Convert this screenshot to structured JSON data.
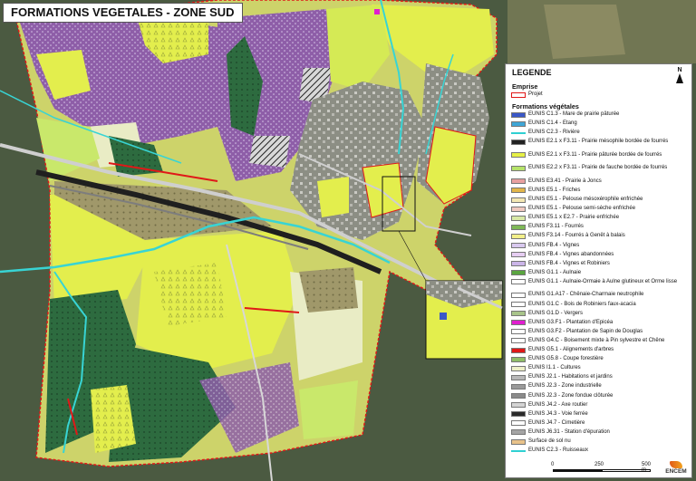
{
  "map": {
    "title": "FORMATIONS VEGETALES - ZONE SUD",
    "colors": {
      "background": "#4b5a41",
      "pasture": "#e3f04a",
      "hay_meadow": "#c9e86b",
      "forest": "#2f6a3e",
      "vineyard": "#8e5ea8",
      "orchard": "#9aa86b",
      "crops": "#e9ecc5",
      "urban": "#8e8e8a",
      "railway": "#1f1f1f",
      "road": "#bdbdbd",
      "river": "#38d4d4",
      "boundary": "#e01818"
    }
  },
  "legend": {
    "title": "LEGENDE",
    "north_label": "N",
    "emprise_title": "Emprise",
    "projet_label": "Projet",
    "formations_title": "Formations végétales",
    "items": [
      {
        "label": "EUNIS C1.3 - Mare de prairie pâturée",
        "color": "#3a57c7"
      },
      {
        "label": "EUNIS C1.4 - Etang",
        "color": "#3fa6d6"
      },
      {
        "label": "EUNIS C2.3 - Rivière",
        "color": "#2fd0d2"
      },
      {
        "label": "EUNIS E2.1 x F3.11 - Prairie mésophile bordée de fourrés",
        "color": "#222222"
      },
      {
        "label": "EUNIS E2.1 x F3.11 - Prairie pâturée bordée de fourrés",
        "color": "#e6f046"
      },
      {
        "label": "EUNIS E2.2 x F3.11 - Prairie de fauche bordée de fourrés",
        "color": "#b6e36a"
      },
      {
        "label": "EUNIS E3.41 - Prairie à Joncs",
        "color": "#e8a0a0"
      },
      {
        "label": "EUNIS E5.1 - Friches",
        "color": "#e2b64a"
      },
      {
        "label": "EUNIS E5.1 - Pelouse mésoxérophile enfrichée",
        "color": "#f3e7b3"
      },
      {
        "label": "EUNIS E5.1 - Pelouse semi-sèche enfrichée",
        "color": "#f0c9c0"
      },
      {
        "label": "EUNIS E5.1 x E2.7 - Prairie enfrichée",
        "color": "#d9e9a6"
      },
      {
        "label": "EUNIS F3.11 - Fourrés",
        "color": "#7fb957"
      },
      {
        "label": "EUNIS F3.14 - Fourrés à Genêt à balais",
        "color": "#f2ef8a"
      },
      {
        "label": "EUNIS FB.4 - Vignes",
        "color": "#d9c9ef"
      },
      {
        "label": "EUNIS FB.4 - Vignes abandonnées",
        "color": "#e6cdf2"
      },
      {
        "label": "EUNIS FB.4 - Vignes et Robiniers",
        "color": "#cbb5e8"
      },
      {
        "label": "EUNIS G1.1 - Aulnaie",
        "color": "#5aa540"
      },
      {
        "label": "EUNIS G1.1 - Aulnaie-Ormaie à Aulne glutineux et Orme lisse",
        "color": "#ffffff"
      },
      {
        "label": "EUNIS G1.A17 - Chênaie-Charmaie neutrophile",
        "color": "#ffffff"
      },
      {
        "label": "EUNIS G1.C - Bois de Robiniers faux-acacia",
        "color": "#ffffff"
      },
      {
        "label": "EUNIS G1.D - Vergers",
        "color": "#a8c48a"
      },
      {
        "label": "EUNIS G3.F1 - Plantation d'Epicéa",
        "color": "#e01ecf"
      },
      {
        "label": "EUNIS G3.F2 - Plantation de Sapin de Douglas",
        "color": "#ffffff"
      },
      {
        "label": "EUNIS G4.C - Boisement mixte à Pin sylvestre et Chêne",
        "color": "#ffffff"
      },
      {
        "label": "EUNIS G5.1 - Alignements d'arbres",
        "color": "#e01818"
      },
      {
        "label": "EUNIS G5.8 - Coupe forestière",
        "color": "#8fbd68"
      },
      {
        "label": "EUNIS I1.1 - Cultures",
        "color": "#eef0c8"
      },
      {
        "label": "EUNIS J2.1 - Habitations et jardins",
        "color": "#b8b8b8"
      },
      {
        "label": "EUNIS J2.3 - Zone industrielle",
        "color": "#9a9a9a"
      },
      {
        "label": "EUNIS J2.3 - Zone fondue clôturée",
        "color": "#8a8a8a"
      },
      {
        "label": "EUNIS J4.2 - Axe routier",
        "color": "#d4d4d4"
      },
      {
        "label": "EUNIS J4.3 - Voie ferrée",
        "color": "#2a2a2a"
      },
      {
        "label": "EUNIS J4.7 - Cimetière",
        "color": "#ffffff"
      },
      {
        "label": "EUNIS J6.31 - Station d'épuration",
        "color": "#a5a5a5"
      },
      {
        "label": "Surface de sol nu",
        "color": "#e8c28a"
      },
      {
        "label": "EUNIS C2.3 - Ruisseaux",
        "color": "#2fd0d2"
      }
    ]
  },
  "scale": {
    "labels": [
      "0",
      "250",
      "500 m"
    ]
  },
  "logo": {
    "text": "ENCEM"
  }
}
